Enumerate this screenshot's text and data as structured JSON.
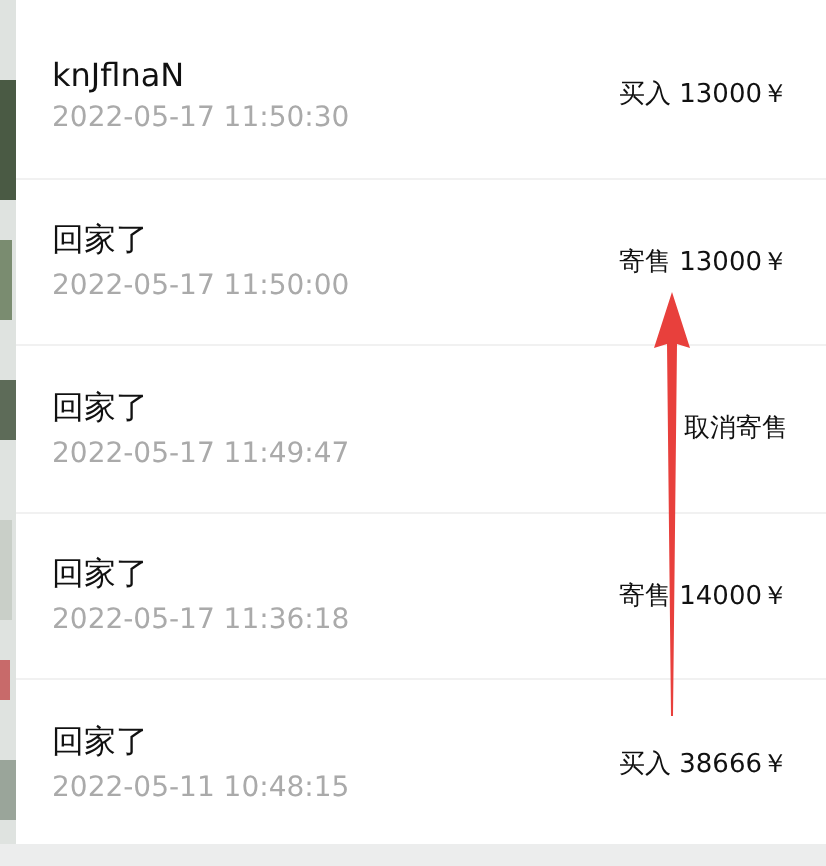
{
  "records": [
    {
      "name": "knJflnaN",
      "time": "2022-05-17 11:50:30",
      "action": "买入 13000￥"
    },
    {
      "name": "回家了",
      "time": "2022-05-17 11:50:00",
      "action": "寄售 13000￥"
    },
    {
      "name": "回家了",
      "time": "2022-05-17 11:49:47",
      "action": "取消寄售"
    },
    {
      "name": "回家了",
      "time": "2022-05-17 11:36:18",
      "action": "寄售 14000￥"
    },
    {
      "name": "回家了",
      "time": "2022-05-11 10:48:15",
      "action": "买入 38666￥"
    }
  ]
}
